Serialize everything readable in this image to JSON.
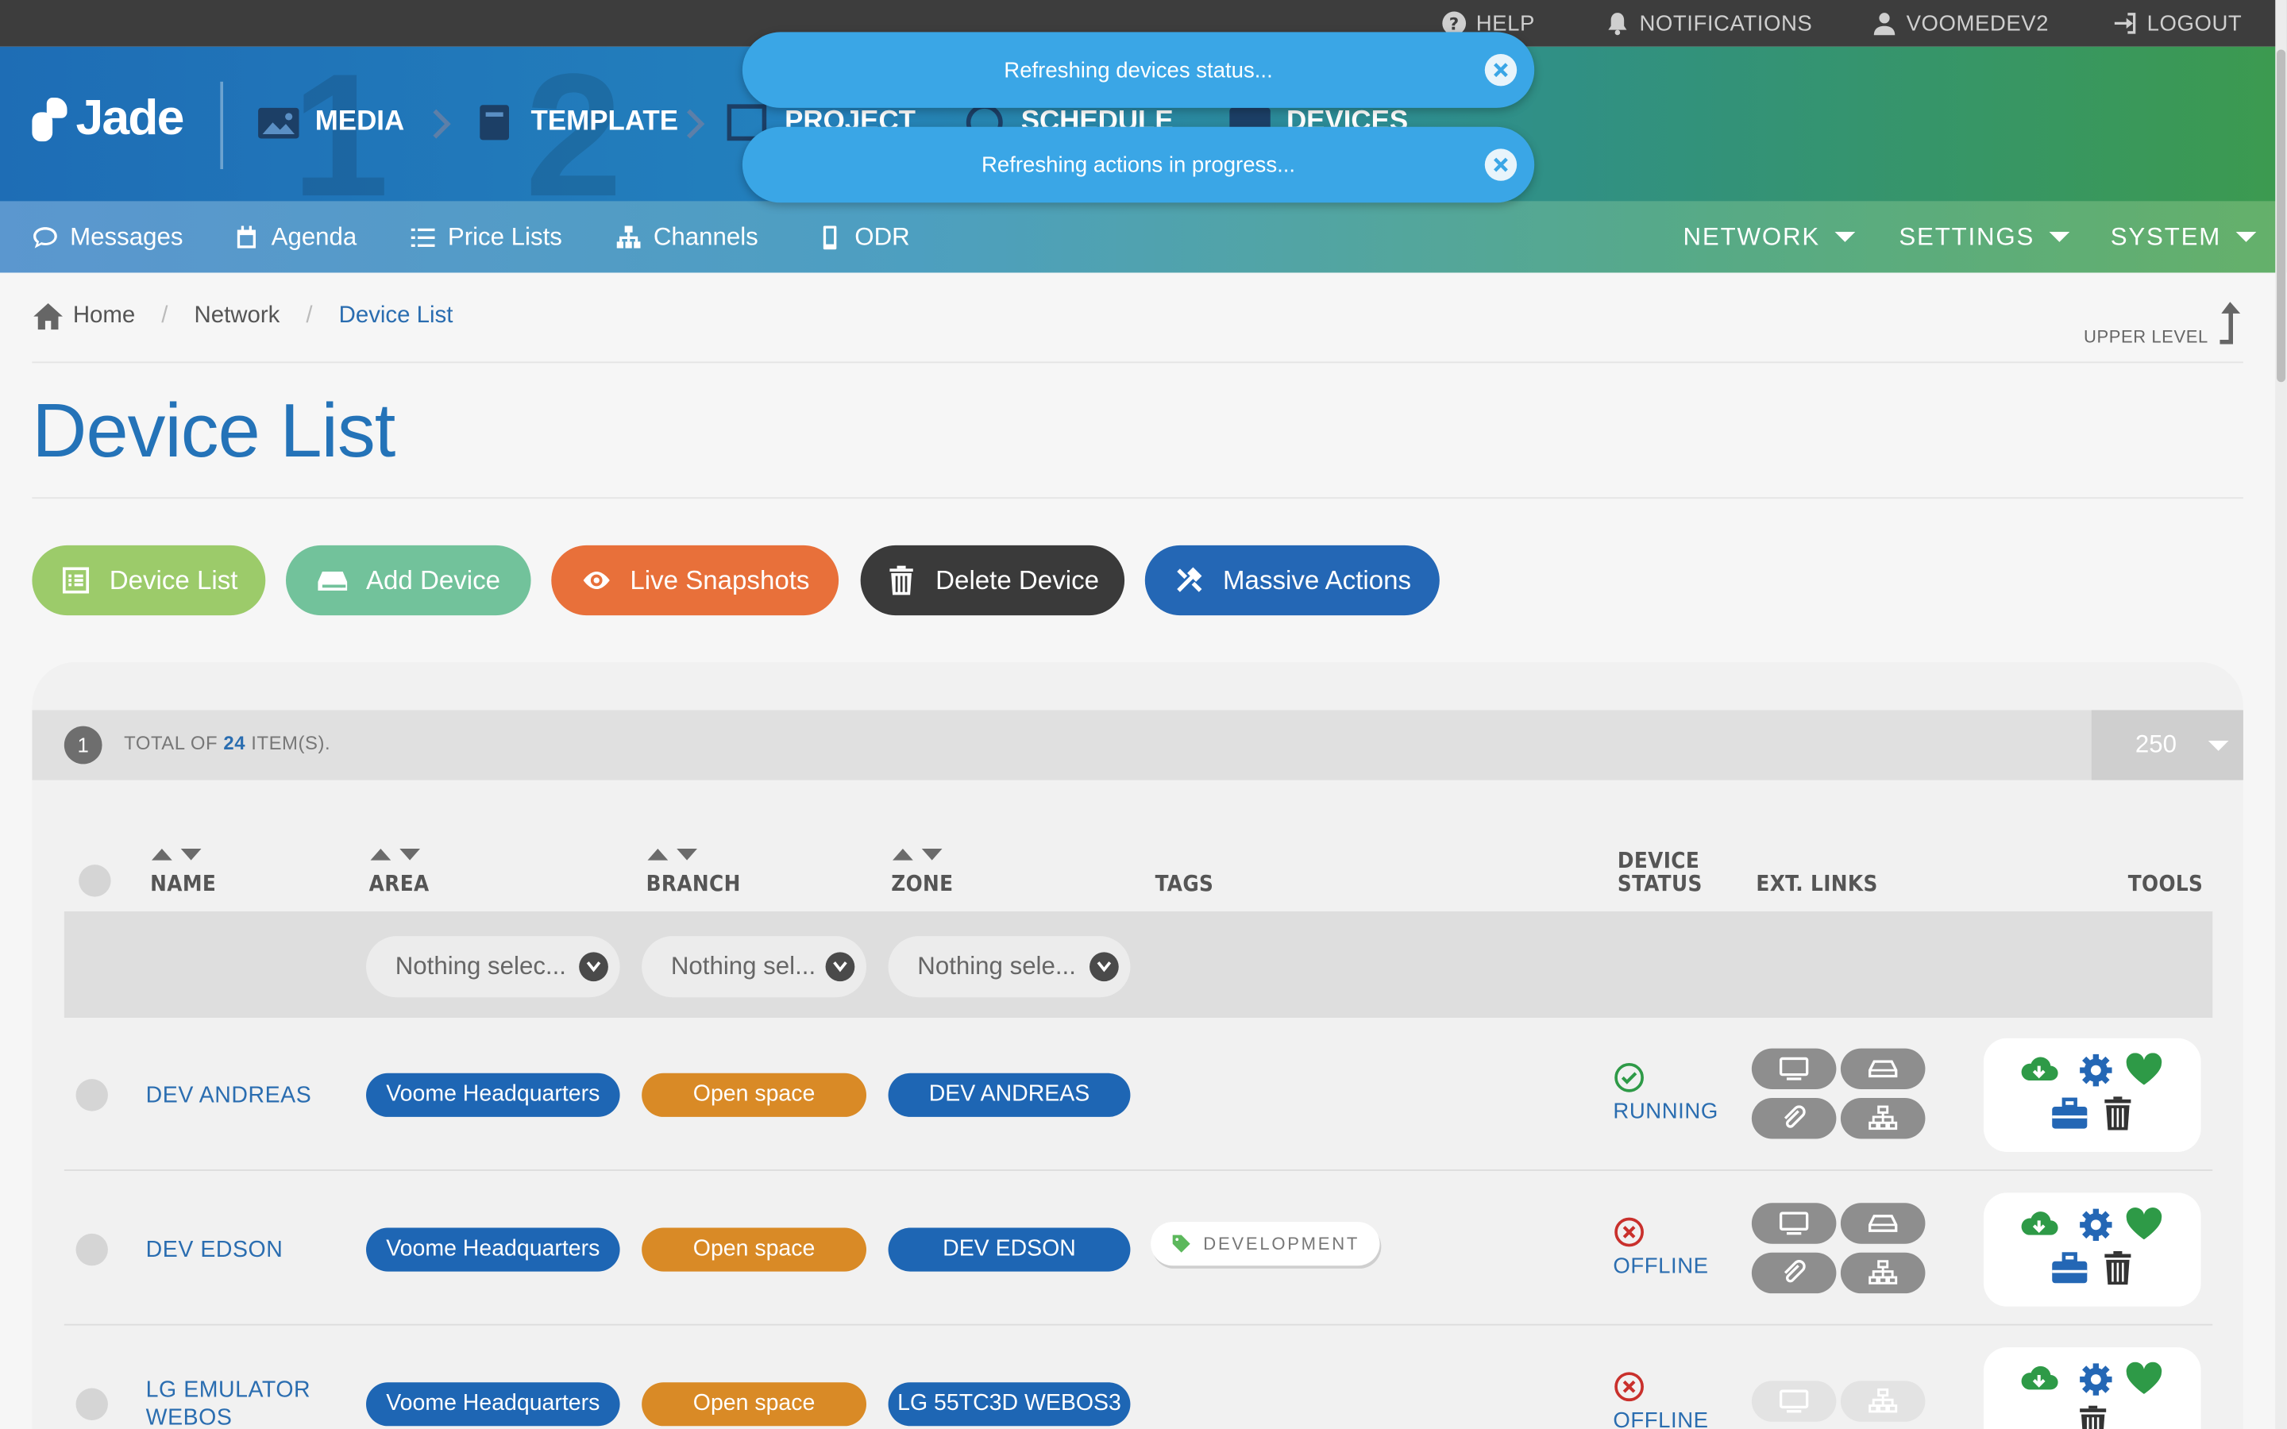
{
  "topbar": {
    "help": "HELP",
    "notifications": "NOTIFICATIONS",
    "user": "VOOMEDEV2",
    "logout": "LOGOUT"
  },
  "header": {
    "logo": "Jade",
    "steps": [
      {
        "label": "MEDIA",
        "icon": "image-icon"
      },
      {
        "label": "TEMPLATE",
        "icon": "book-icon"
      },
      {
        "label": "PROJECT",
        "icon": "project-icon"
      },
      {
        "label": "SCHEDULE",
        "icon": "clock-icon"
      },
      {
        "label": "DEVICES",
        "icon": "monitor-icon"
      }
    ]
  },
  "toasts": [
    {
      "text": "Refreshing devices status..."
    },
    {
      "text": "Refreshing actions in progress..."
    }
  ],
  "subnav": {
    "items": [
      {
        "label": "Messages",
        "icon": "chat-icon"
      },
      {
        "label": "Agenda",
        "icon": "calendar-icon"
      },
      {
        "label": "Price Lists",
        "icon": "list-icon"
      },
      {
        "label": "Channels",
        "icon": "sitemap-icon"
      },
      {
        "label": "ODR",
        "icon": "phone-icon"
      }
    ],
    "menus": [
      {
        "label": "NETWORK"
      },
      {
        "label": "SETTINGS"
      },
      {
        "label": "SYSTEM"
      }
    ]
  },
  "breadcrumb": {
    "items": [
      "Home",
      "Network",
      "Device List"
    ],
    "upper_level": "UPPER LEVEL"
  },
  "page_title": "Device List",
  "actions": [
    {
      "label": "Device List",
      "color": "#9ccb6a",
      "icon": "list-alt-icon"
    },
    {
      "label": "Add Device",
      "color": "#72c29b",
      "icon": "hdd-icon"
    },
    {
      "label": "Live Snapshots",
      "color": "#e8703a",
      "icon": "eye-icon"
    },
    {
      "label": "Delete Device",
      "color": "#3a3a3a",
      "icon": "trash-icon"
    },
    {
      "label": "Massive Actions",
      "color": "#2467b5",
      "icon": "tools-icon"
    }
  ],
  "pager": {
    "page": "1",
    "total_prefix": "TOTAL OF",
    "total_count": "24",
    "total_suffix": "ITEM(S).",
    "page_size": "250"
  },
  "table": {
    "headers": {
      "name": "NAME",
      "area": "AREA",
      "branch": "BRANCH",
      "zone": "ZONE",
      "tags": "TAGS",
      "status_line1": "DEVICE",
      "status_line2": "STATUS",
      "ext_links": "EXT. LINKS",
      "tools": "TOOLS"
    },
    "filters": {
      "area": "Nothing selec...",
      "branch": "Nothing sel...",
      "zone": "Nothing sele..."
    },
    "rows": [
      {
        "name_line1": "DEV ANDREAS",
        "name_line2": "",
        "area": "Voome Headquarters",
        "branch": "Open space",
        "zone": "DEV ANDREAS",
        "tag": "",
        "status": "RUNNING",
        "status_color": "#2e9a47"
      },
      {
        "name_line1": "DEV EDSON",
        "name_line2": "",
        "area": "Voome Headquarters",
        "branch": "Open space",
        "zone": "DEV EDSON",
        "tag": "DEVELOPMENT",
        "status": "OFFLINE",
        "status_color": "#c9302c"
      },
      {
        "name_line1": "LG EMULATOR",
        "name_line2": "WEBOS",
        "area": "Voome Headquarters",
        "branch": "Open space",
        "zone": "LG 55TC3D WEBOS3",
        "tag": "",
        "status": "OFFLINE",
        "status_color": "#c9302c"
      }
    ]
  }
}
